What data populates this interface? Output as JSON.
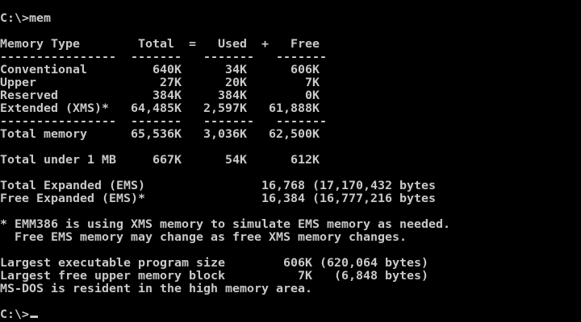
{
  "terminal": {
    "command_line": "C:\\>mem",
    "table": {
      "header": "Memory Type        Total  =   Used  +   Free",
      "divider_top": "----------------  -------   -------   -------",
      "rows": [
        "Conventional         640K      34K      606K",
        "Upper                 27K      20K        7K",
        "Reserved             384K     384K        0K",
        "Extended (XMS)*   64,485K   2,597K   61,888K"
      ],
      "divider_bottom": "----------------  -------   -------   -------",
      "total": "Total memory      65,536K   3,036K   62,500K",
      "under_1mb": "Total under 1 MB     667K      54K      612K"
    },
    "ems": {
      "total": "Total Expanded (EMS)                16,768 (17,170,432 bytes",
      "free": "Free Expanded (EMS)*                16,384 (16,777,216 bytes"
    },
    "note": {
      "line1": "* EMM386 is using XMS memory to simulate EMS memory as needed.",
      "line2": "  Free EMS memory may change as free XMS memory changes."
    },
    "summary": {
      "largest_program": "Largest executable program size        606K (620,064 bytes)",
      "largest_upper": "Largest free upper memory block          7K   (6,848 bytes)",
      "dos_high": "MS-DOS is resident in the high memory area."
    },
    "prompt": "C:\\>"
  }
}
